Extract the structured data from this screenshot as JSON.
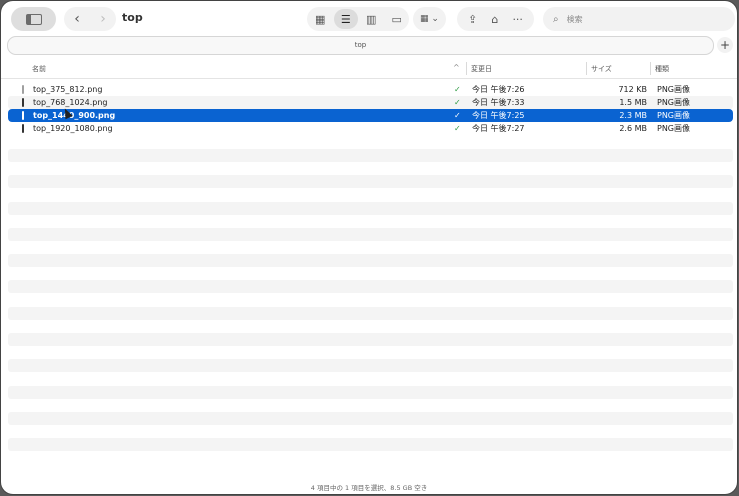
{
  "window": {
    "title": "top"
  },
  "toolbar": {
    "sidebar_icon": "sidebar-icon",
    "back_glyph": "‹",
    "forward_glyph": "›",
    "view_icons": [
      "grid-view-icon",
      "list-view-icon",
      "column-view-icon",
      "gallery-view-icon"
    ],
    "group_glyph": "▦ ⌄",
    "share_glyph": "⇪",
    "tag_glyph": "⌂",
    "more_glyph": "···",
    "search_icon": "search-icon",
    "search_placeholder": "検索"
  },
  "pathbar": {
    "label": "top"
  },
  "add_tab": "+",
  "columns": {
    "name": "名前",
    "sort_indicator": "^",
    "modified": "変更日",
    "size": "サイズ",
    "kind": "種類"
  },
  "files": [
    {
      "name": "top_375_812.png",
      "modified": "今日 午後7:26",
      "size": "712 KB",
      "kind": "PNG画像"
    },
    {
      "name": "top_768_1024.png",
      "modified": "今日 午後7:33",
      "size": "1.5 MB",
      "kind": "PNG画像"
    },
    {
      "name": "top_1440_900.png",
      "modified": "今日 午後7:25",
      "size": "2.3 MB",
      "kind": "PNG画像"
    },
    {
      "name": "top_1920_1080.png",
      "modified": "今日 午後7:27",
      "size": "2.6 MB",
      "kind": "PNG画像"
    }
  ],
  "status_check_glyph": "✓",
  "selected_index": 2,
  "colors": {
    "selection": "#0a63d1",
    "icloud_check": "#2c9a41"
  },
  "statusbar": {
    "text": "4 項目中の 1 項目を選択、8.5 GB 空き"
  }
}
